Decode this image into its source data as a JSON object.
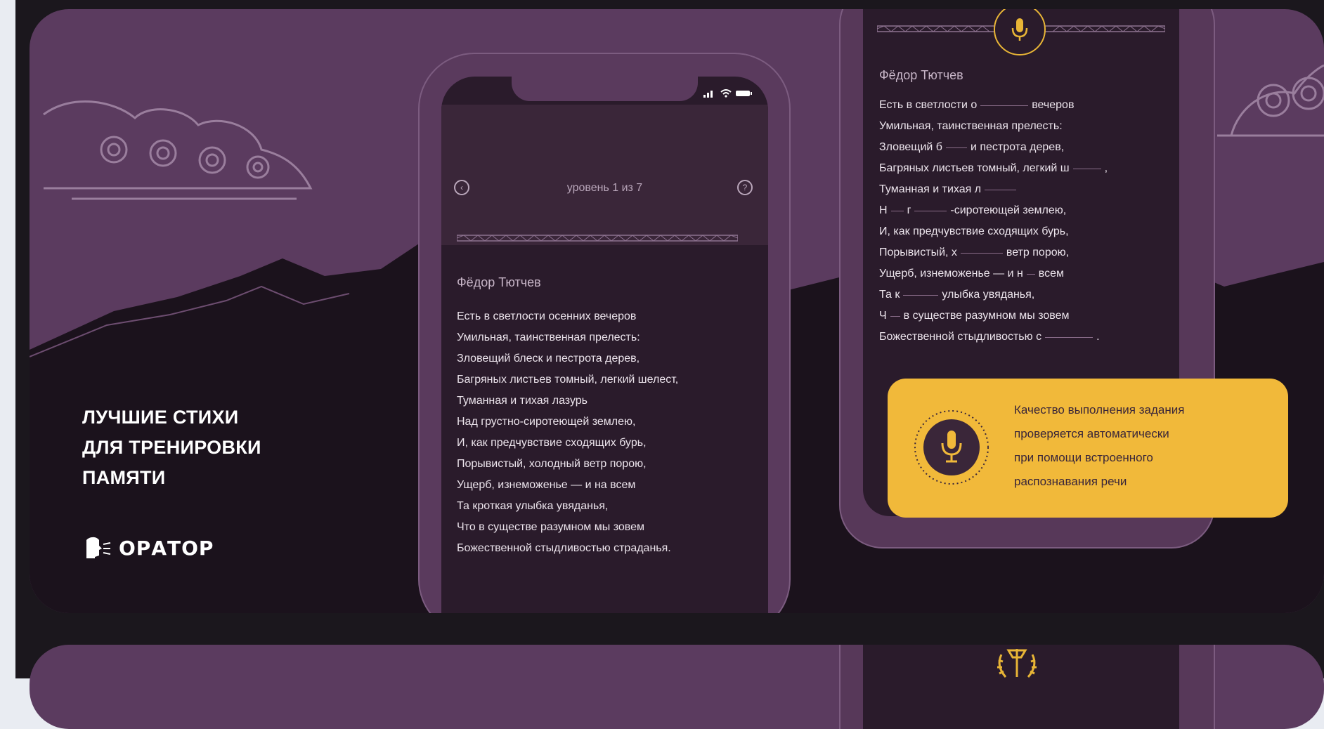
{
  "hero": {
    "headline": [
      "ЛУЧШИЕ СТИХИ",
      "ДЛЯ ТРЕНИРОВКИ",
      "ПАМЯТИ"
    ],
    "brand_name": "ОРАТОР"
  },
  "phone_left": {
    "level_label": "уровень 1 из 7",
    "author": "Фёдор Тютчев",
    "poem_lines": [
      "Есть в светлости осенних вечеров",
      "Умильная, таинственная прелесть:",
      "Зловещий блеск и пестрота дерев,",
      "Багряных листьев томный, легкий шелест,",
      "Туманная и тихая лазурь",
      "Над грустно-сиротеющей землею,",
      "И, как предчувствие сходящих бурь,",
      "Порывистый, холодный ветр порою,",
      "Ущерб, изнеможенье — и на всем",
      "Та кроткая улыбка увяданья,",
      "Что в существе разумном мы зовем",
      "Божественной стыдливостью страданья."
    ]
  },
  "phone_right": {
    "author": "Фёдор Тютчев",
    "poem_lines": [
      [
        "Есть в светлости о",
        "__",
        "вечеров"
      ],
      [
        "Умильная, таинственная прелесть:"
      ],
      [
        "Зловещий б",
        "__",
        "и пестрота дерев,"
      ],
      [
        "Багряных листьев томный, легкий ш",
        "__",
        ","
      ],
      [
        "Туманная и тихая л",
        "__"
      ],
      [
        "Н",
        "_",
        "г",
        "__",
        "-сиротеющей землею,"
      ],
      [
        "И, как предчувствие сходящих бурь,"
      ],
      [
        "Порывистый, х",
        "__",
        "ветр порою,"
      ],
      [
        "Ущерб, изнеможенье — и н",
        "_",
        "всем"
      ],
      [
        "Та к",
        "__",
        "улыбка увяданья,"
      ],
      [
        "Ч",
        "_",
        "в существе разумном мы зовем"
      ],
      [
        "Божественной стыдливостью с",
        "__",
        "."
      ]
    ]
  },
  "callout": {
    "lines": [
      "Качество выполнения задания",
      "проверяется автоматически",
      "при помощи встроенного",
      "распознавания речи"
    ]
  },
  "colors": {
    "card_purple": "#5b3b5f",
    "mountains_dark": "#1b121c",
    "callout_yellow": "#f1b93a",
    "accent_gold": "#e8b536"
  },
  "icons": {
    "back": "back-arrow-icon",
    "help": "question-icon",
    "mic": "microphone-icon",
    "wreath": "laurel-wreath-icon"
  }
}
